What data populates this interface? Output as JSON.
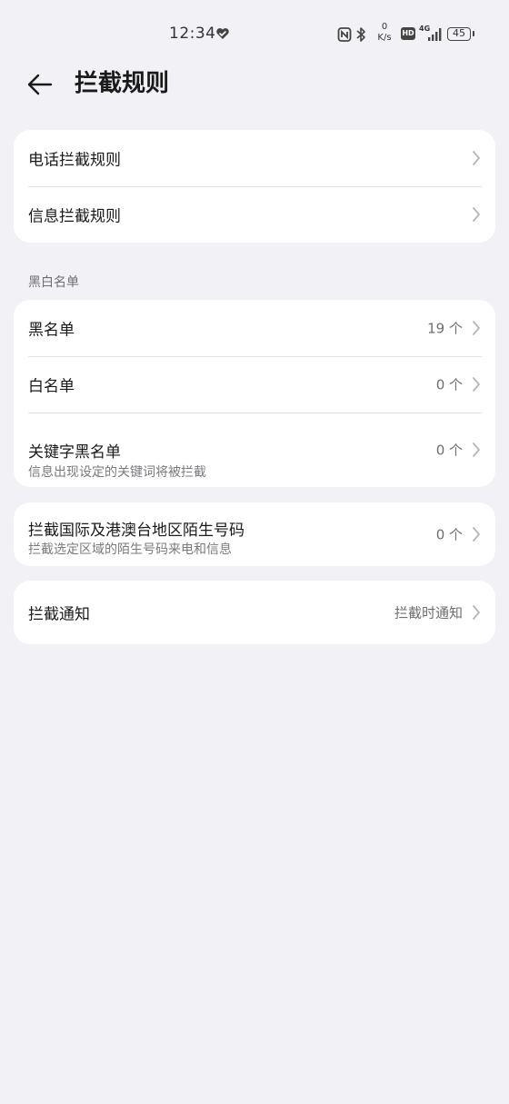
{
  "status_bar": {
    "time": "12:34",
    "net_speed_value": "0",
    "net_speed_unit": "K/s",
    "hd_label": "HD",
    "network_label": "4G",
    "battery": "45"
  },
  "header": {
    "title": "拦截规则"
  },
  "rules_card": {
    "items": [
      {
        "label": "电话拦截规则"
      },
      {
        "label": "信息拦截规则"
      }
    ]
  },
  "list_section": {
    "label": "黑白名单",
    "items": [
      {
        "label": "黑名单",
        "value": "19 个"
      },
      {
        "label": "白名单",
        "value": "0 个"
      },
      {
        "label": "关键字黑名单",
        "subtitle": "信息出现设定的关键词将被拦截",
        "value": "0 个"
      }
    ]
  },
  "international_card": {
    "label": "拦截国际及港澳台地区陌生号码",
    "subtitle": "拦截选定区域的陌生号码来电和信息",
    "value": "0 个"
  },
  "notify_card": {
    "label": "拦截通知",
    "value": "拦截时通知"
  },
  "colors": {
    "background": "#f1f1f6",
    "card": "#ffffff",
    "primary_text": "#1a1a1a",
    "secondary_text": "#6e6e72"
  }
}
